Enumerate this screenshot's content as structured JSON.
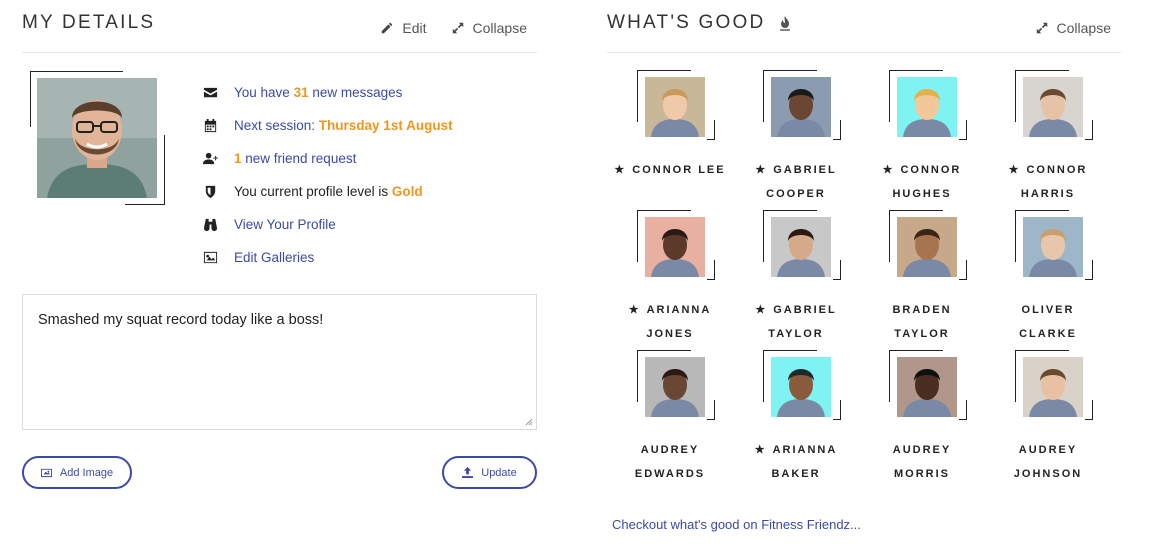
{
  "left_panel": {
    "title": "MY DETAILS",
    "edit_label": "Edit",
    "collapse_label": "Collapse",
    "details": {
      "messages_prefix": "You have ",
      "messages_count": "31",
      "messages_suffix": " new messages",
      "session_prefix": "Next session: ",
      "session_date": "Thursday 1st August",
      "friend_count": "1",
      "friend_suffix": " new friend request",
      "level_prefix": "You current profile level is ",
      "level_value": "Gold",
      "view_profile": "View Your Profile",
      "edit_galleries": "Edit Galleries"
    },
    "status_text": "Smashed my squat record today like a boss!",
    "add_image_label": "Add Image",
    "update_label": "Update"
  },
  "right_panel": {
    "title": "WHAT'S GOOD",
    "collapse_label": "Collapse",
    "people": [
      {
        "line1": "CONNOR LEE",
        "line2": "",
        "starred": true
      },
      {
        "line1": "GABRIEL",
        "line2": "COOPER",
        "starred": true
      },
      {
        "line1": "CONNOR",
        "line2": "HUGHES",
        "starred": true
      },
      {
        "line1": "CONNOR",
        "line2": "HARRIS",
        "starred": true
      },
      {
        "line1": "ARIANNA",
        "line2": "JONES",
        "starred": true
      },
      {
        "line1": "GABRIEL",
        "line2": "TAYLOR",
        "starred": true
      },
      {
        "line1": "BRADEN",
        "line2": "TAYLOR",
        "starred": false
      },
      {
        "line1": "OLIVER",
        "line2": "CLARKE",
        "starred": false
      },
      {
        "line1": "AUDREY",
        "line2": "EDWARDS",
        "starred": false
      },
      {
        "line1": "ARIANNA",
        "line2": "BAKER",
        "starred": true
      },
      {
        "line1": "AUDREY",
        "line2": "MORRIS",
        "starred": false
      },
      {
        "line1": "AUDREY",
        "line2": "JOHNSON",
        "starred": false
      }
    ],
    "checkout_link": "Checkout what's good on Fitness Friendz..."
  },
  "colors": {
    "accent_blue": "#3b4aa6",
    "highlight_orange": "#f0961e"
  }
}
